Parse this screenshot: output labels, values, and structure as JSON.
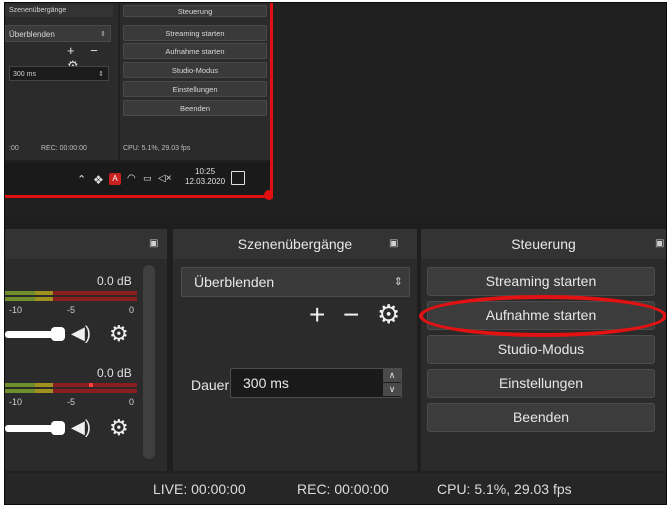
{
  "inset": {
    "transitions_header": "Szenenübergänge",
    "transition_select": "Überblenden",
    "duration": "300 ms",
    "icons": "+ − ⚙",
    "control_header": "Steuerung",
    "buttons": [
      "Streaming starten",
      "Aufnahme starten",
      "Studio-Modus",
      "Einstellungen",
      "Beenden"
    ],
    "status_live": ":00",
    "status_rec": "REC: 00:00:00",
    "status_cpu": "CPU: 5.1%, 29.03 fps",
    "taskbar": {
      "time": "10:25",
      "date": "12.03.2020",
      "tray_icons": [
        "chevron-up-icon",
        "dropbox-icon",
        "adobe-icon",
        "wifi-icon",
        "battery-icon",
        "speaker-icon"
      ]
    }
  },
  "mixer": {
    "track1_db": "0.0 dB",
    "track2_db": "0.0 dB",
    "ticks": [
      "-10",
      "-5",
      "0"
    ]
  },
  "transitions": {
    "header": "Szenenübergänge",
    "selected": "Überblenden",
    "duration_label": "Dauer",
    "duration_value": "300 ms"
  },
  "controls": {
    "header": "Steuerung",
    "streaming": "Streaming starten",
    "recording": "Aufnahme starten",
    "studio": "Studio-Modus",
    "settings": "Einstellungen",
    "quit": "Beenden"
  },
  "status": {
    "live": "LIVE: 00:00:00",
    "rec": "REC: 00:00:00",
    "cpu": "CPU: 5.1%, 29.03 fps"
  },
  "colors": {
    "highlight": "#e31212",
    "meter_green": "#6f8f2a",
    "meter_yellow": "#a0901e",
    "meter_red": "#8a1e1e"
  }
}
